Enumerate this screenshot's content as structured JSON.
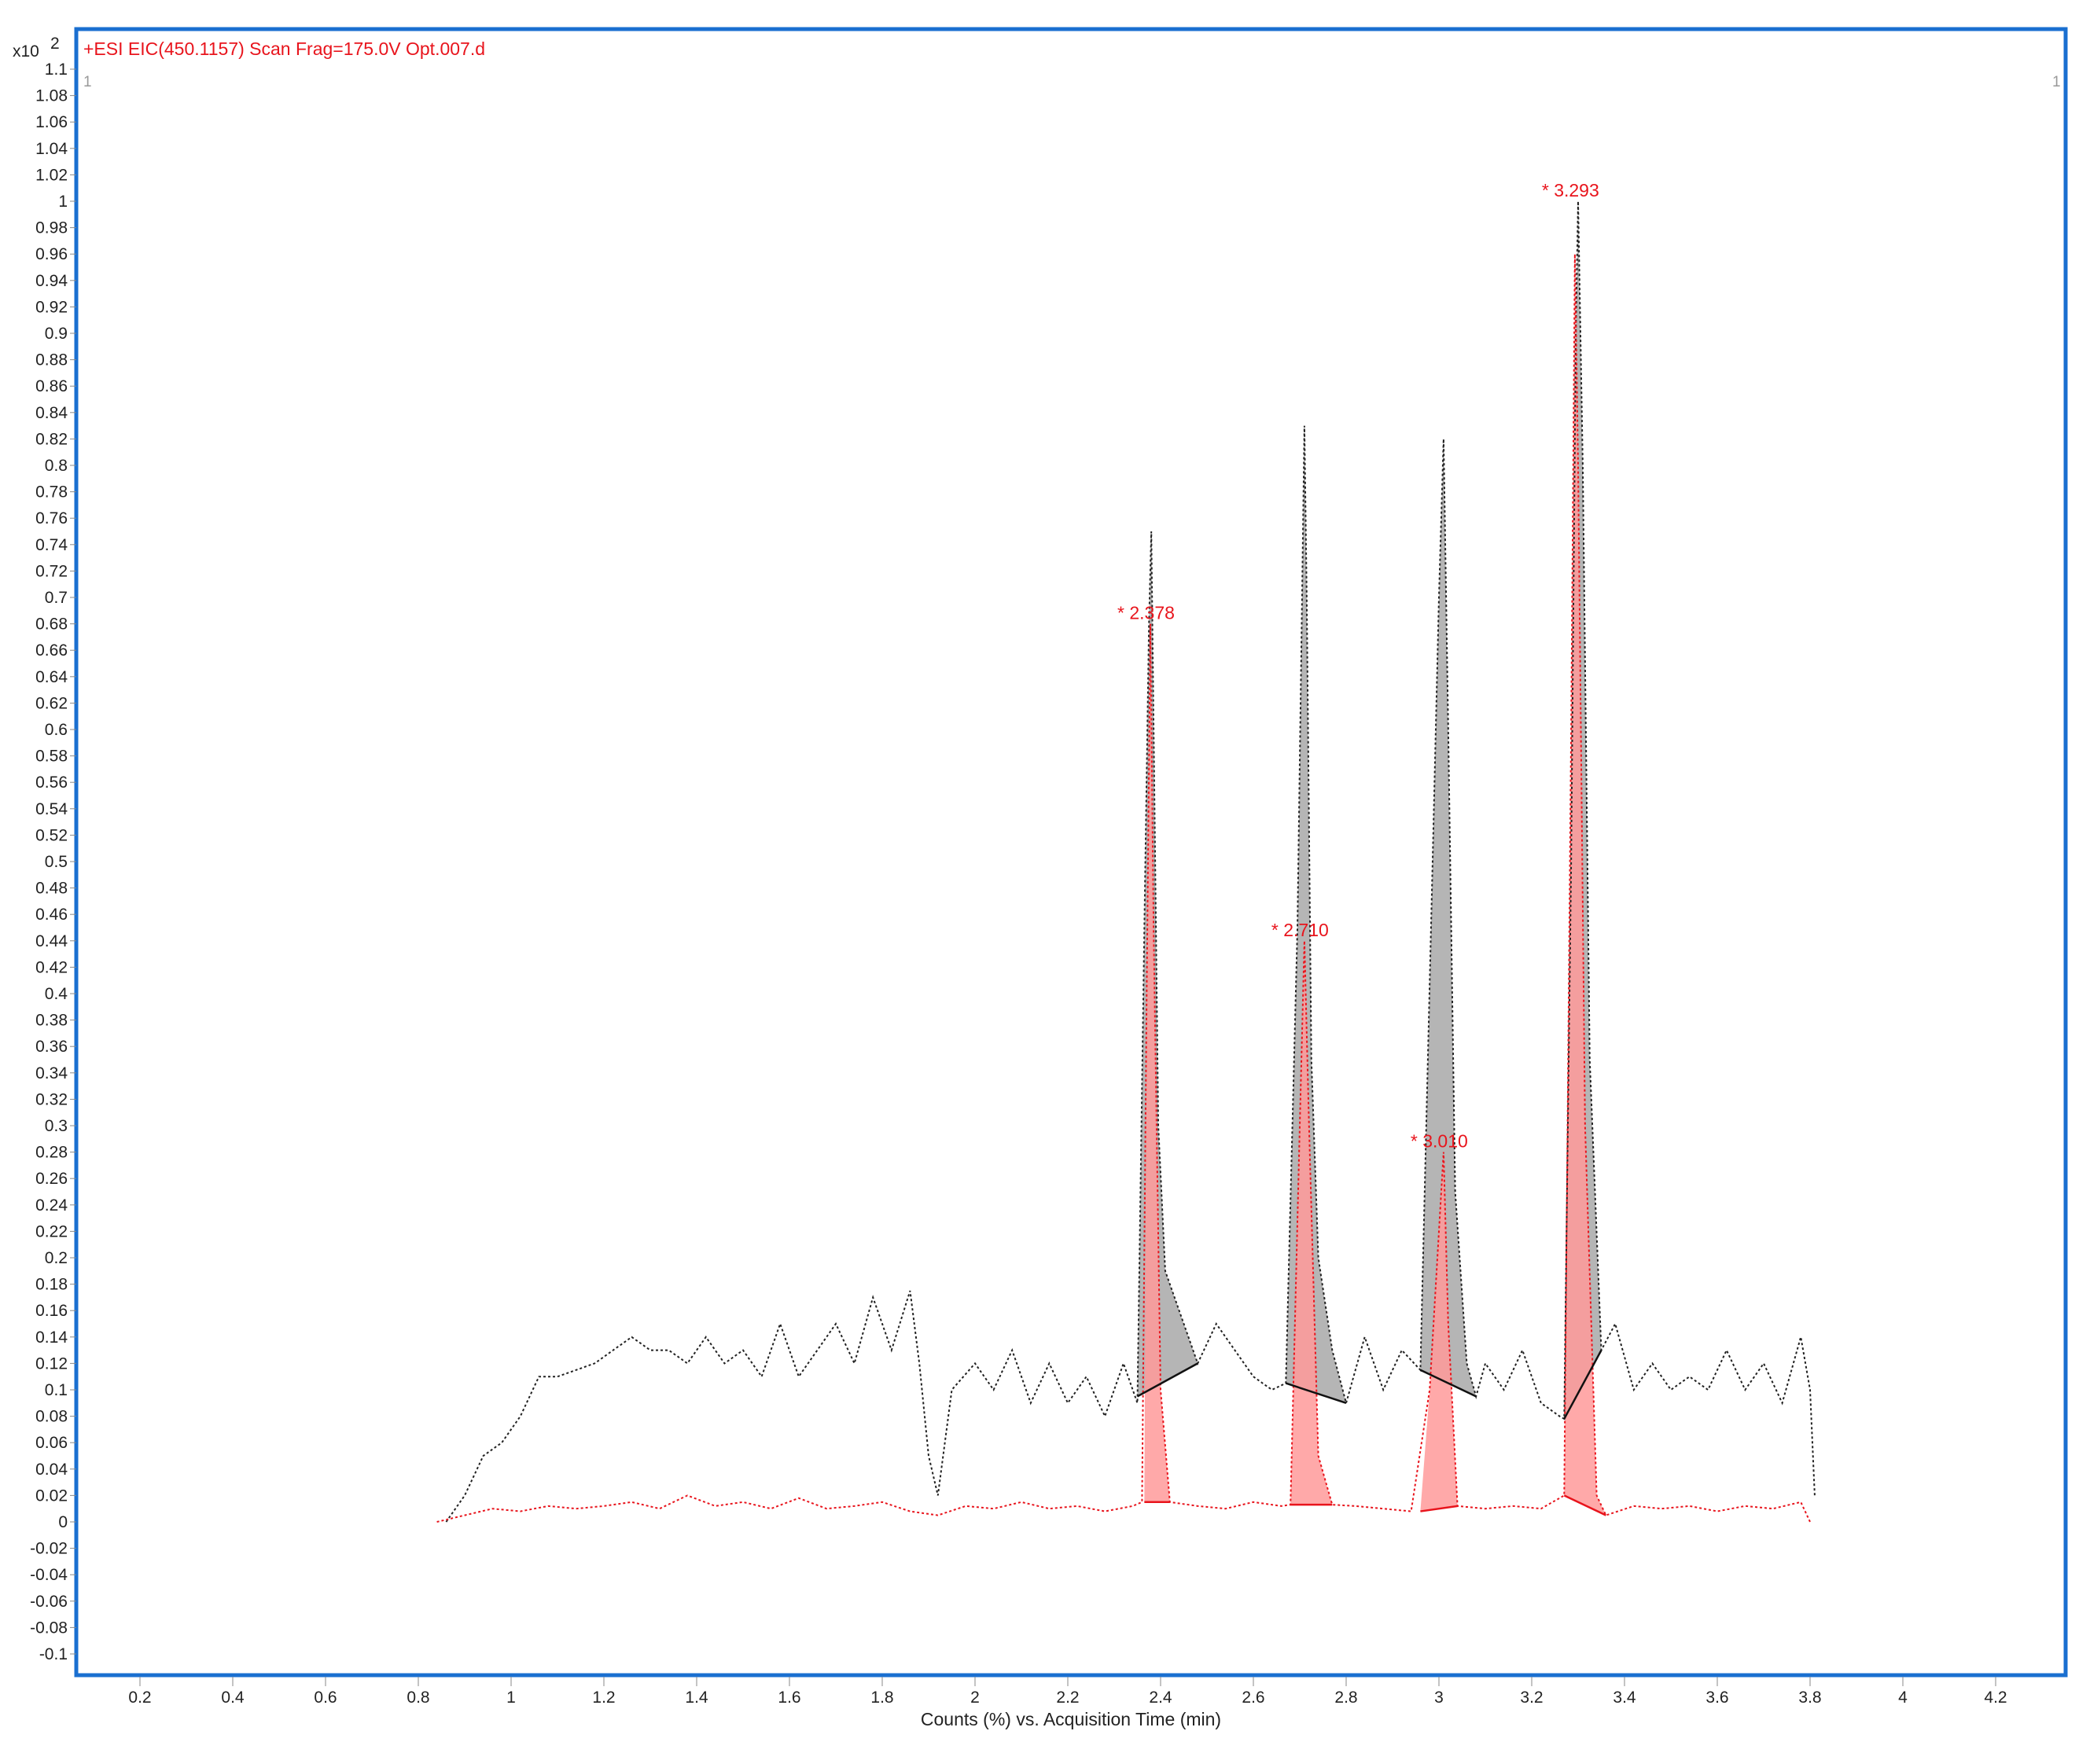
{
  "chart_data": {
    "type": "line",
    "title": "",
    "legend": "+ESI EIC(450.1157) Scan Frag=175.0V Opt.007.d",
    "legend_placement": "top-left",
    "y_multiplier": "x10",
    "y_multiplier_exp": "2",
    "corner_marker_left": "1",
    "corner_marker_right": "1",
    "xlabel": "Counts (%) vs. Acquisition Time (min)",
    "ylabel": "",
    "xlim": [
      0.06,
      4.36
    ],
    "ylim": [
      -0.12,
      1.12
    ],
    "x_ticks": [
      "0.2",
      "0.4",
      "0.6",
      "0.8",
      "1",
      "1.2",
      "1.4",
      "1.6",
      "1.8",
      "2",
      "2.2",
      "2.4",
      "2.6",
      "2.8",
      "3",
      "3.2",
      "3.4",
      "3.6",
      "3.8",
      "4",
      "4.2"
    ],
    "y_ticks": [
      "1.1",
      "1.08",
      "1.06",
      "1.04",
      "1.02",
      "1",
      "0.98",
      "0.96",
      "0.94",
      "0.92",
      "0.9",
      "0.88",
      "0.86",
      "0.84",
      "0.82",
      "0.8",
      "0.78",
      "0.76",
      "0.74",
      "0.72",
      "0.7",
      "0.68",
      "0.66",
      "0.64",
      "0.62",
      "0.6",
      "0.58",
      "0.56",
      "0.54",
      "0.52",
      "0.5",
      "0.48",
      "0.46",
      "0.44",
      "0.42",
      "0.4",
      "0.38",
      "0.36",
      "0.34",
      "0.32",
      "0.3",
      "0.28",
      "0.26",
      "0.24",
      "0.22",
      "0.2",
      "0.18",
      "0.16",
      "0.14",
      "0.12",
      "0.1",
      "0.08",
      "0.06",
      "0.04",
      "0.02",
      "0",
      "-0.02",
      "-0.04",
      "-0.06",
      "-0.08",
      "-0.1"
    ],
    "grid": false,
    "colors": {
      "frame": "#1a6fd0",
      "trace_black": "#222222",
      "trace_red": "#e8141c",
      "fill_gray": "#a8a8a8",
      "fill_red": "#ff9a9a"
    },
    "series": [
      {
        "name": "black-trace",
        "x": [
          0.86,
          0.9,
          0.94,
          0.98,
          1.02,
          1.06,
          1.1,
          1.14,
          1.18,
          1.22,
          1.26,
          1.3,
          1.34,
          1.38,
          1.42,
          1.46,
          1.5,
          1.54,
          1.58,
          1.62,
          1.66,
          1.7,
          1.74,
          1.78,
          1.82,
          1.86,
          1.88,
          1.9,
          1.92,
          1.95,
          2.0,
          2.04,
          2.08,
          2.12,
          2.16,
          2.2,
          2.24,
          2.28,
          2.32,
          2.35,
          2.365,
          2.375,
          2.38,
          2.385,
          2.395,
          2.41,
          2.44,
          2.48,
          2.52,
          2.56,
          2.6,
          2.64,
          2.67,
          2.695,
          2.705,
          2.71,
          2.715,
          2.725,
          2.74,
          2.77,
          2.8,
          2.84,
          2.88,
          2.92,
          2.96,
          2.985,
          3.0,
          3.01,
          3.02,
          3.035,
          3.06,
          3.08,
          3.1,
          3.14,
          3.18,
          3.22,
          3.26,
          3.27,
          3.285,
          3.295,
          3.3,
          3.31,
          3.325,
          3.35,
          3.38,
          3.42,
          3.46,
          3.5,
          3.54,
          3.58,
          3.62,
          3.66,
          3.7,
          3.74,
          3.78,
          3.8,
          3.81
        ],
        "y": [
          0.0,
          0.02,
          0.05,
          0.06,
          0.08,
          0.11,
          0.11,
          0.115,
          0.12,
          0.13,
          0.14,
          0.13,
          0.13,
          0.12,
          0.14,
          0.12,
          0.13,
          0.11,
          0.15,
          0.11,
          0.13,
          0.15,
          0.12,
          0.17,
          0.13,
          0.175,
          0.12,
          0.05,
          0.02,
          0.1,
          0.12,
          0.1,
          0.13,
          0.09,
          0.12,
          0.09,
          0.11,
          0.08,
          0.12,
          0.09,
          0.45,
          0.68,
          0.75,
          0.6,
          0.3,
          0.19,
          0.16,
          0.12,
          0.15,
          0.13,
          0.11,
          0.1,
          0.105,
          0.45,
          0.7,
          0.83,
          0.7,
          0.35,
          0.2,
          0.13,
          0.09,
          0.14,
          0.1,
          0.13,
          0.115,
          0.48,
          0.7,
          0.82,
          0.6,
          0.25,
          0.12,
          0.095,
          0.12,
          0.1,
          0.13,
          0.09,
          0.08,
          0.078,
          0.5,
          0.9,
          1.0,
          0.8,
          0.35,
          0.13,
          0.15,
          0.1,
          0.12,
          0.1,
          0.11,
          0.1,
          0.13,
          0.1,
          0.12,
          0.09,
          0.14,
          0.1,
          0.02
        ]
      },
      {
        "name": "red-trace",
        "x": [
          0.84,
          0.9,
          0.96,
          1.02,
          1.08,
          1.14,
          1.2,
          1.26,
          1.32,
          1.38,
          1.44,
          1.5,
          1.56,
          1.62,
          1.68,
          1.74,
          1.8,
          1.86,
          1.92,
          1.98,
          2.04,
          2.1,
          2.16,
          2.22,
          2.28,
          2.34,
          2.36,
          2.37,
          2.378,
          2.385,
          2.4,
          2.42,
          2.48,
          2.54,
          2.6,
          2.66,
          2.68,
          2.7,
          2.71,
          2.72,
          2.74,
          2.77,
          2.82,
          2.88,
          2.94,
          2.98,
          3.0,
          3.01,
          3.02,
          3.04,
          3.1,
          3.16,
          3.22,
          3.27,
          3.285,
          3.293,
          3.3,
          3.315,
          3.34,
          3.36,
          3.42,
          3.48,
          3.54,
          3.6,
          3.66,
          3.72,
          3.78,
          3.8
        ],
        "y": [
          0.0,
          0.005,
          0.01,
          0.008,
          0.012,
          0.01,
          0.012,
          0.015,
          0.01,
          0.02,
          0.012,
          0.015,
          0.01,
          0.018,
          0.01,
          0.012,
          0.015,
          0.008,
          0.005,
          0.012,
          0.01,
          0.015,
          0.01,
          0.012,
          0.008,
          0.012,
          0.015,
          0.4,
          0.68,
          0.45,
          0.1,
          0.015,
          0.012,
          0.01,
          0.015,
          0.012,
          0.013,
          0.3,
          0.44,
          0.3,
          0.05,
          0.013,
          0.012,
          0.01,
          0.008,
          0.1,
          0.22,
          0.28,
          0.15,
          0.012,
          0.01,
          0.012,
          0.01,
          0.02,
          0.6,
          0.96,
          0.8,
          0.3,
          0.02,
          0.005,
          0.012,
          0.01,
          0.012,
          0.008,
          0.012,
          0.01,
          0.015,
          0.0
        ]
      }
    ],
    "peaks": [
      {
        "label": "* 2.378",
        "rt": 2.378,
        "height": 0.68,
        "gray_baseline": [
          [
            2.35,
            0.095
          ],
          [
            2.48,
            0.12
          ]
        ],
        "red_baseline": [
          [
            2.365,
            0.015
          ],
          [
            2.42,
            0.015
          ]
        ]
      },
      {
        "label": "* 2.710",
        "rt": 2.71,
        "height": 0.44,
        "gray_baseline": [
          [
            2.67,
            0.105
          ],
          [
            2.8,
            0.09
          ]
        ],
        "red_baseline": [
          [
            2.68,
            0.013
          ],
          [
            2.77,
            0.013
          ]
        ]
      },
      {
        "label": "* 3.010",
        "rt": 3.01,
        "height": 0.28,
        "gray_baseline": [
          [
            2.96,
            0.115
          ],
          [
            3.08,
            0.095
          ]
        ],
        "red_baseline": [
          [
            2.96,
            0.008
          ],
          [
            3.04,
            0.012
          ]
        ]
      },
      {
        "label": "* 3.293",
        "rt": 3.293,
        "height": 1.0,
        "gray_baseline": [
          [
            3.27,
            0.078
          ],
          [
            3.35,
            0.13
          ]
        ],
        "red_baseline": [
          [
            3.27,
            0.02
          ],
          [
            3.36,
            0.005
          ]
        ]
      }
    ]
  }
}
